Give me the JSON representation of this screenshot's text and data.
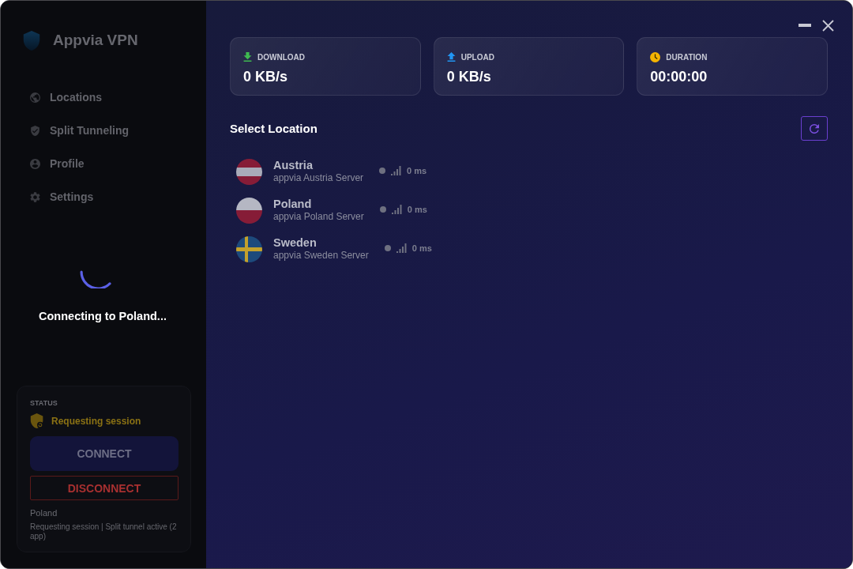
{
  "app": {
    "name": "Appvia VPN"
  },
  "nav": [
    {
      "kind": "locations",
      "label": "Locations"
    },
    {
      "kind": "tunneling",
      "label": "Split Tunneling"
    },
    {
      "kind": "profile",
      "label": "Profile"
    },
    {
      "kind": "settings",
      "label": "Settings"
    }
  ],
  "connecting_overlay": {
    "text": "Connecting to Poland..."
  },
  "status_panel": {
    "heading": "STATUS",
    "state": "Requesting session",
    "connect_button": {
      "label": "CONNECT",
      "disabled": true
    },
    "disconnect_button": {
      "label": "DISCONNECT"
    },
    "location": "Poland",
    "detail": "Requesting session | Split tunnel active (2 app)"
  },
  "stats": [
    {
      "kind": "download",
      "label": "DOWNLOAD",
      "value": "0 KB/s"
    },
    {
      "kind": "upload",
      "label": "UPLOAD",
      "value": "0 KB/s"
    },
    {
      "kind": "duration",
      "label": "DURATION",
      "value": "00:00:00"
    }
  ],
  "location_list": {
    "title": "Select Location",
    "items": [
      {
        "kind": "austria",
        "name": "Austria",
        "server": "appvia Austria Server",
        "ping": "0 ms"
      },
      {
        "kind": "poland",
        "name": "Poland",
        "server": "appvia Poland Server",
        "ping": "0 ms"
      },
      {
        "kind": "sweden",
        "name": "Sweden",
        "server": "appvia Sweden Server",
        "ping": "0 ms"
      }
    ]
  }
}
